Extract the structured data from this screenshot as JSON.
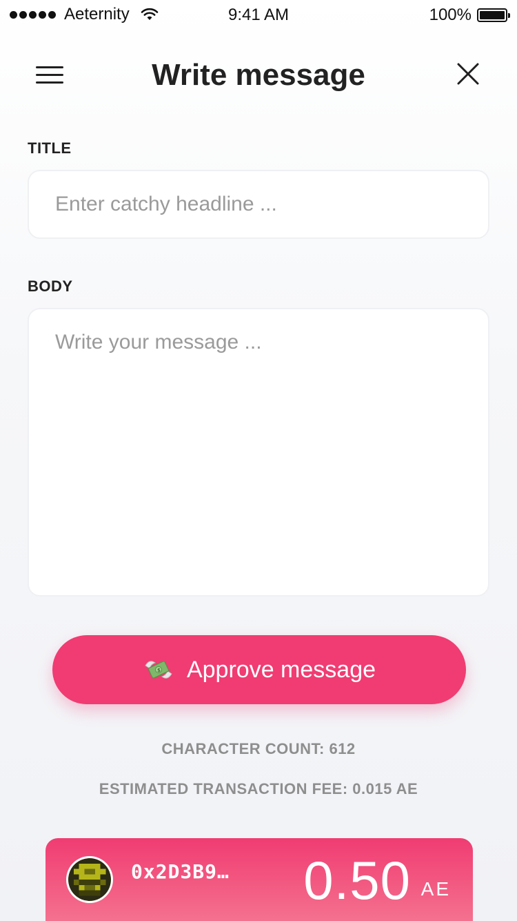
{
  "status_bar": {
    "carrier": "Aeternity",
    "time": "9:41 AM",
    "battery": "100%"
  },
  "header": {
    "title": "Write message",
    "menu_icon": "hamburger-menu-icon",
    "close_icon": "close-icon"
  },
  "form": {
    "title_label": "TITLE",
    "title_placeholder": "Enter catchy headline ...",
    "title_value": "",
    "body_label": "BODY",
    "body_placeholder": "Write your message ...",
    "body_value": ""
  },
  "approve_button": {
    "label": "Approve message",
    "icon": "money-with-wings-icon"
  },
  "info": {
    "character_count": "CHARACTER COUNT: 612",
    "transaction_fee": "ESTIMATED TRANSACTION FEE: 0.015 AE"
  },
  "account": {
    "address": "0x2D3B9…",
    "balance": "0.50",
    "currency": "AE"
  },
  "colors": {
    "accent": "#f03c72",
    "card_gradient_end": "#f57a93",
    "label_gray": "#8e8e8e"
  }
}
